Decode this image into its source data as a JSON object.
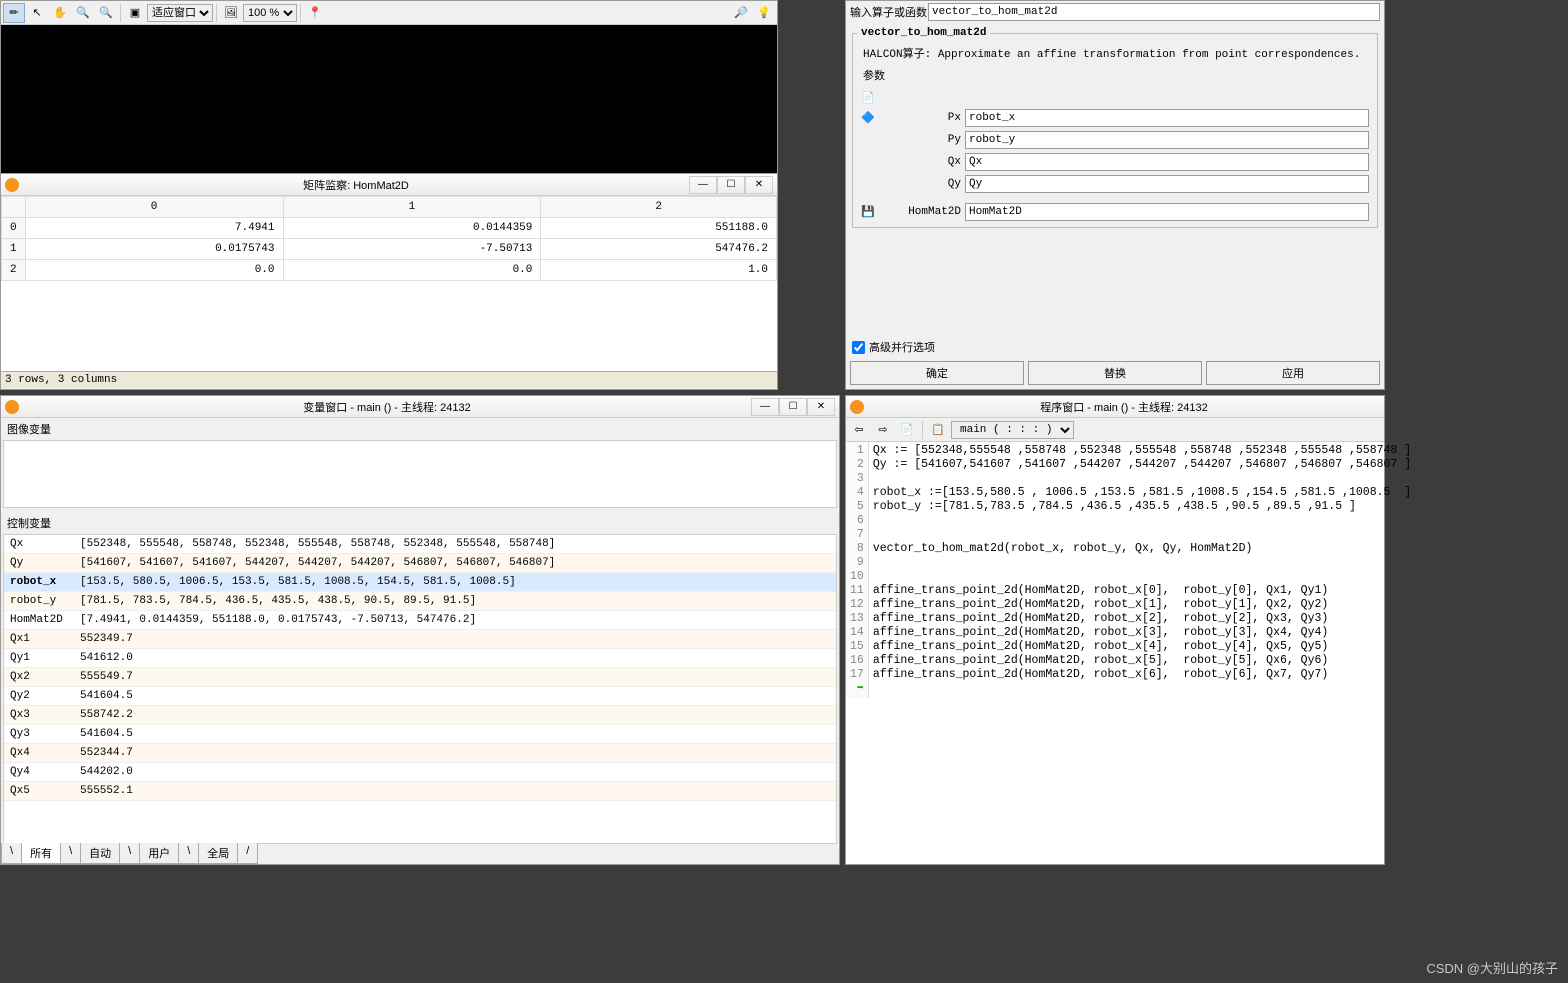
{
  "graphics": {
    "fit_window_label": "适应窗口",
    "zoom_value": "100 %"
  },
  "matrix_window": {
    "title": "矩阵监察: HomMat2D",
    "cols": [
      "0",
      "1",
      "2"
    ],
    "rows": [
      {
        "h": "0",
        "c": [
          "7.4941",
          "0.0144359",
          "551188.0"
        ]
      },
      {
        "h": "1",
        "c": [
          "0.0175743",
          "-7.50713",
          "547476.2"
        ]
      },
      {
        "h": "2",
        "c": [
          "0.0",
          "0.0",
          "1.0"
        ]
      }
    ],
    "status": "3 rows, 3 columns"
  },
  "var_window": {
    "title": "变量窗口 - main () - 主线程: 24132",
    "image_vars_label": "图像变量",
    "control_vars_label": "控制变量",
    "vars": [
      {
        "name": "Qx",
        "val": "[552348, 555548, 558748, 552348, 555548, 558748, 552348, 555548, 558748]"
      },
      {
        "name": "Qy",
        "val": "[541607, 541607, 541607, 544207, 544207, 544207, 546807, 546807, 546807]"
      },
      {
        "name": "robot_x",
        "val": "[153.5, 580.5, 1006.5, 153.5, 581.5, 1008.5, 154.5, 581.5, 1008.5]",
        "sel": true
      },
      {
        "name": "robot_y",
        "val": "[781.5, 783.5, 784.5, 436.5, 435.5, 438.5, 90.5, 89.5, 91.5]"
      },
      {
        "name": "HomMat2D",
        "val": "[7.4941, 0.0144359, 551188.0, 0.0175743, -7.50713, 547476.2]"
      },
      {
        "name": "Qx1",
        "val": "552349.7"
      },
      {
        "name": "Qy1",
        "val": "541612.0"
      },
      {
        "name": "Qx2",
        "val": "555549.7"
      },
      {
        "name": "Qy2",
        "val": "541604.5"
      },
      {
        "name": "Qx3",
        "val": "558742.2"
      },
      {
        "name": "Qy3",
        "val": "541604.5"
      },
      {
        "name": "Qx4",
        "val": "552344.7"
      },
      {
        "name": "Qy4",
        "val": "544202.0"
      },
      {
        "name": "Qx5",
        "val": "555552.1"
      }
    ],
    "tabs": [
      "所有",
      "自动",
      "用户",
      "全局"
    ]
  },
  "operator": {
    "input_label": "输入算子或函数",
    "operator_name": "vector_to_hom_mat2d",
    "legend": "vector_to_hom_mat2d",
    "halcon_label": "HALCON算子:",
    "description": "Approximate an affine transformation from point correspondences.",
    "params_label": "参数",
    "params": [
      {
        "name": "Px",
        "val": "robot_x"
      },
      {
        "name": "Py",
        "val": "robot_y"
      },
      {
        "name": "Qx",
        "val": "Qx"
      },
      {
        "name": "Qy",
        "val": "Qy"
      }
    ],
    "output_param": {
      "name": "HomMat2D",
      "val": "HomMat2D"
    },
    "advanced_label": "高级并行选项",
    "buttons": {
      "ok": "确定",
      "replace": "替换",
      "apply": "应用"
    }
  },
  "code_window": {
    "title": "程序窗口 - main () - 主线程: 24132",
    "proc_sel": "main ( : : : )",
    "lines": [
      "Qx := [552348,555548 ,558748 ,552348 ,555548 ,558748 ,552348 ,555548 ,558748 ]",
      "Qy := [541607,541607 ,541607 ,544207 ,544207 ,544207 ,546807 ,546807 ,546807 ]",
      "",
      "robot_x :=[153.5,580.5 , 1006.5 ,153.5 ,581.5 ,1008.5 ,154.5 ,581.5 ,1008.5  ]",
      "robot_y :=[781.5,783.5 ,784.5 ,436.5 ,435.5 ,438.5 ,90.5 ,89.5 ,91.5 ]",
      "",
      "",
      "vector_to_hom_mat2d(robot_x, robot_y, Qx, Qy, HomMat2D)",
      "",
      "",
      "affine_trans_point_2d(HomMat2D, robot_x[0],  robot_y[0], Qx1, Qy1)",
      "affine_trans_point_2d(HomMat2D, robot_x[1],  robot_y[1], Qx2, Qy2)",
      "affine_trans_point_2d(HomMat2D, robot_x[2],  robot_y[2], Qx3, Qy3)",
      "affine_trans_point_2d(HomMat2D, robot_x[3],  robot_y[3], Qx4, Qy4)",
      "affine_trans_point_2d(HomMat2D, robot_x[4],  robot_y[4], Qx5, Qy5)",
      "affine_trans_point_2d(HomMat2D, robot_x[5],  robot_y[5], Qx6, Qy6)",
      "affine_trans_point_2d(HomMat2D, robot_x[6],  robot_y[6], Qx7, Qy7)"
    ]
  },
  "watermark": "CSDN @大别山的孩子"
}
